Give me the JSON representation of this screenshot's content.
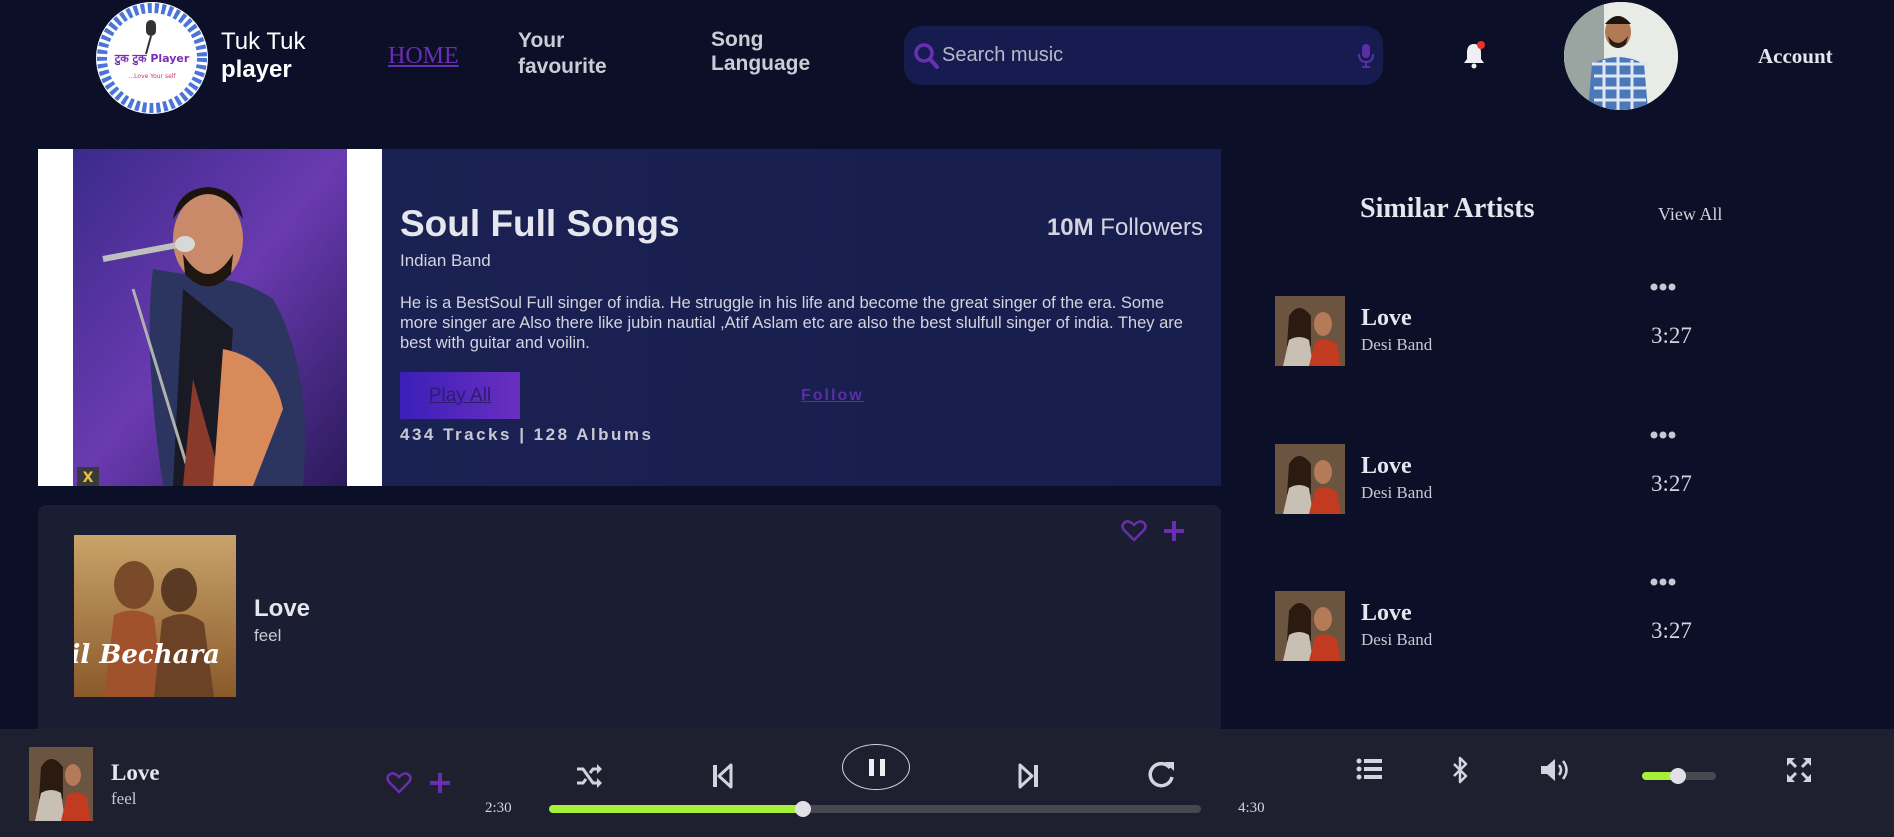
{
  "header": {
    "brand_line1": "Tuk Tuk",
    "brand_line2": "player",
    "logo_icon": "microphone-logo",
    "logo_text": "टुक टुक Player",
    "logo_tagline": "...Love Your self",
    "nav": {
      "home": "HOME",
      "favourite": "Your favourite",
      "language": "Song Language"
    },
    "search_placeholder": "Search music",
    "account": "Account"
  },
  "artist": {
    "title": "Soul Full Songs",
    "subtitle": "Indian Band",
    "followers_count": "10M",
    "followers_label": "Followers",
    "description": "He is a BestSoul Full singer of india. He struggle in his life and become the great singer of the era. Some more singer are Also there like jubin nautial ,Atif Aslam etc are also the best slulfull singer of india. They are best with guitar and voilin.",
    "play_all": "Play All",
    "follow": "Follow",
    "tracks_info": "434 Tracks | 128 Albums"
  },
  "song": {
    "title": "Love",
    "subtitle": "feel",
    "cover_text": "Dil Bechara"
  },
  "similar": {
    "title": "Similar Artists",
    "view_all": "View All",
    "items": [
      {
        "title": "Love",
        "subtitle": "Desi Band",
        "duration": "3:27"
      },
      {
        "title": "Love",
        "subtitle": "Desi Band",
        "duration": "3:27"
      },
      {
        "title": "Love",
        "subtitle": "Desi Band",
        "duration": "3:27"
      }
    ]
  },
  "player": {
    "title": "Love",
    "subtitle": "feel",
    "current_time": "2:30",
    "total_time": "4:30",
    "progress": 0.39,
    "volume": 0.48
  },
  "colors": {
    "background": "#0b0f27",
    "accent_purple": "#6a2fb0",
    "progress_green": "#a6f03a",
    "player_bar": "#1e2030"
  }
}
